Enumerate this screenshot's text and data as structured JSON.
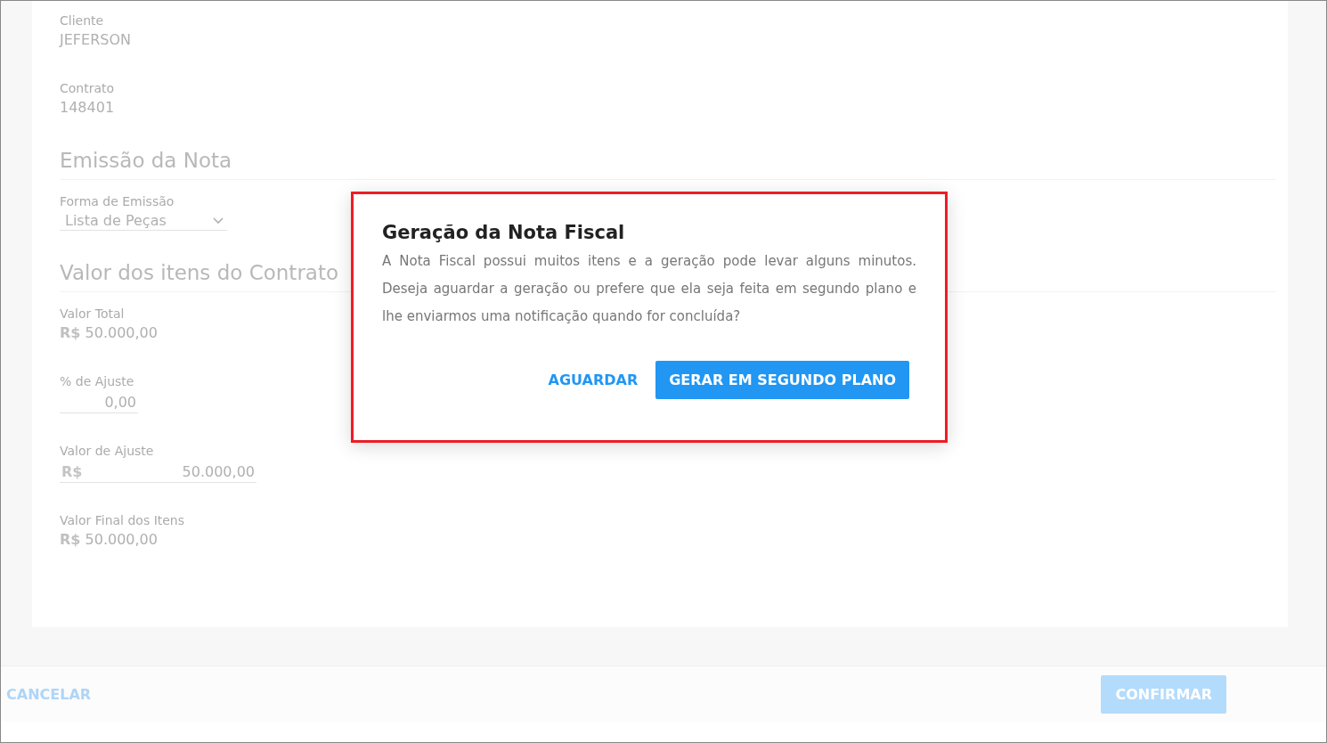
{
  "fields": [
    {
      "kind": "text",
      "label": "Cliente",
      "value": "JEFERSON"
    },
    {
      "kind": "text",
      "label": "Contrato",
      "value": "148401"
    }
  ],
  "sections": [
    {
      "title": "Emissão da Nota",
      "fields": [
        {
          "kind": "select",
          "label": "Forma de Emissão",
          "value": "Lista de Peças"
        }
      ]
    },
    {
      "title": "Valor dos itens do Contrato",
      "fields": [
        {
          "kind": "text",
          "label": "Valor Total",
          "value": "**R$** 50.000,00"
        },
        {
          "kind": "input",
          "label": "% de Ajuste",
          "value": "0,00"
        },
        {
          "kind": "currency_input",
          "label": "Valor de Ajuste",
          "prefix": "R$",
          "value": "50.000,00"
        },
        {
          "kind": "text",
          "label": "Valor Final dos Itens",
          "value": "**R$** 50.000,00"
        }
      ]
    }
  ],
  "footer": {
    "buttons": [
      {
        "kind": "text",
        "label": "CANCELAR"
      },
      {
        "kind": "primary",
        "label": "CONFIRMAR"
      }
    ]
  },
  "dialog": {
    "title": "Geração da Nota Fiscal",
    "message": "A Nota Fiscal possui muitos itens e a geração pode levar alguns minutos. Deseja aguardar a geração ou prefere que ela seja feita em segundo plano e lhe enviarmos uma notificação quando for concluída?",
    "buttons": [
      {
        "kind": "text",
        "label": "AGUARDAR"
      },
      {
        "kind": "primary",
        "label": "GERAR EM SEGUNDO PLANO"
      }
    ]
  }
}
